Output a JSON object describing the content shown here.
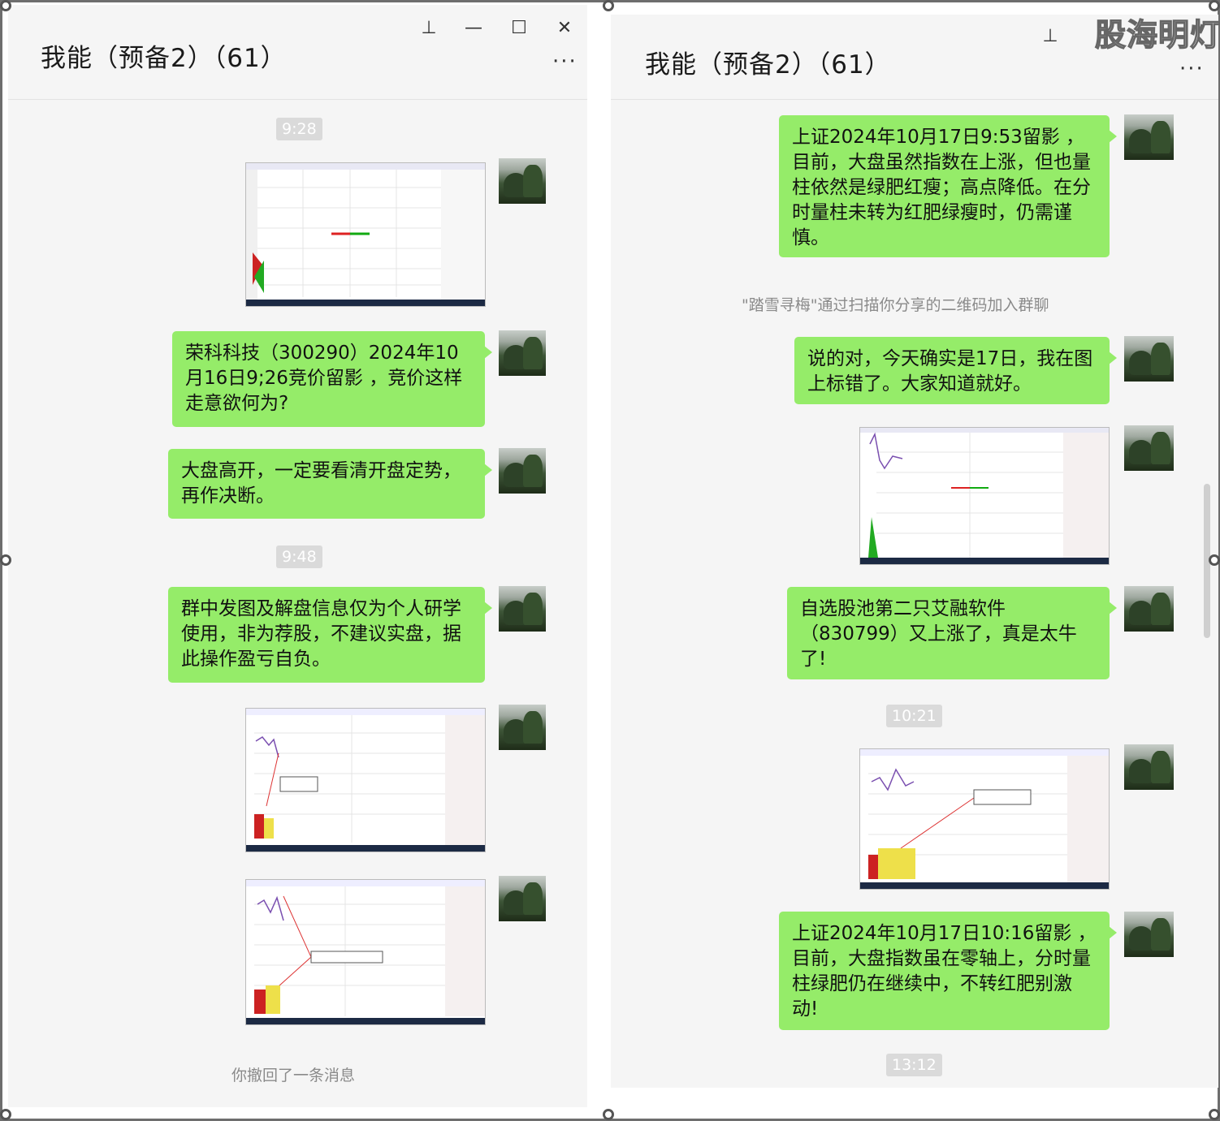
{
  "watermark": "股海明灯",
  "left_window": {
    "title": "我能（预备2）（61）",
    "controls": {
      "pin": "⊥",
      "minimize": "—",
      "maximize": "☐",
      "close": "✕",
      "more": "···"
    },
    "time_1": "9:28",
    "msg_1": "荣科科技（300290）2024年10月16日9;26竞价留影 ，竞价这样走意欲何为?",
    "msg_2": "大盘高开，一定要看清开盘定势，再作决断。",
    "time_2": "9:48",
    "msg_3": "群中发图及解盘信息仅为个人研学使用，非为荐股，不建议实盘，据此操作盈亏自负。",
    "system_recall": "你撤回了一条消息"
  },
  "right_window": {
    "title": "我能（预备2）（61）",
    "controls": {
      "pin": "⊥",
      "more": "···"
    },
    "msg_1": "上证2024年10月17日9:53留影 ，目前，大盘虽然指数在上涨，但也量柱依然是绿肥红瘦；高点降低。在分时量柱未转为红肥绿瘦时，仍需谨慎。",
    "system_join": "\"踏雪寻梅\"通过扫描你分享的二维码加入群聊",
    "msg_2": "说的对，今天确实是17日，我在图上标错了。大家知道就好。",
    "msg_3": "自选股池第二只艾融软件（830799）又上涨了，真是太牛了!",
    "time_1": "10:21",
    "msg_4": "上证2024年10月17日10:16留影 ，目前，大盘指数虽在零轴上，分时量柱绿肥仍在继续中，不转红肥别激动!",
    "time_2": "13:12"
  }
}
